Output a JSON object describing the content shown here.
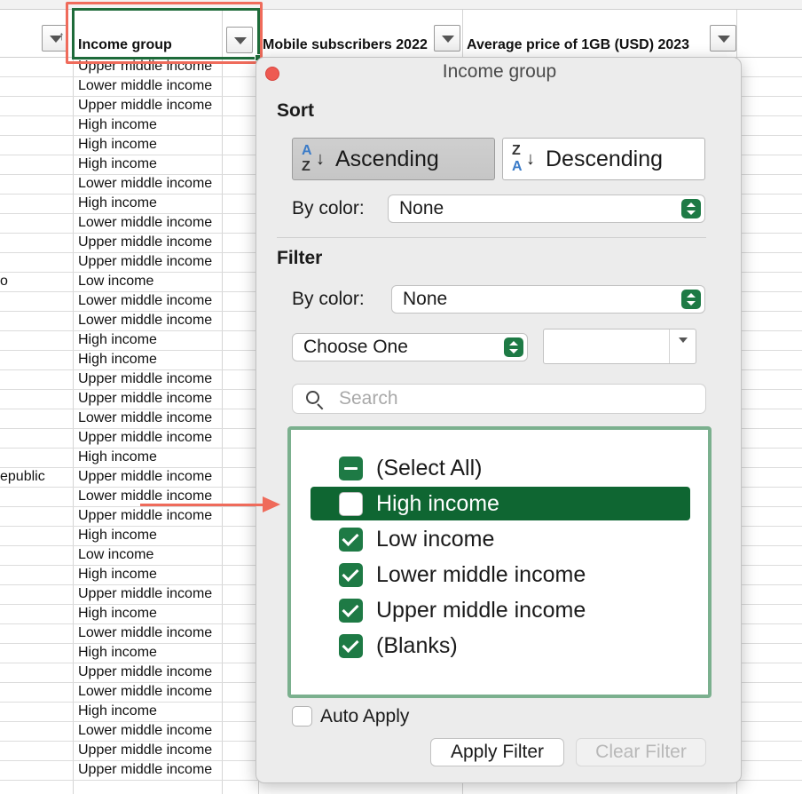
{
  "sheet": {
    "headers": {
      "income_group": "Income group",
      "mobile_subscribers": "Mobile subscribers 2022",
      "avg_price": "Average price of 1GB (USD) 2023"
    },
    "rows": [
      {
        "left": "",
        "income": "Upper middle income"
      },
      {
        "left": "",
        "income": "Lower middle income"
      },
      {
        "left": "",
        "income": "Upper middle income"
      },
      {
        "left": "",
        "income": "High income"
      },
      {
        "left": "",
        "income": "High income"
      },
      {
        "left": "",
        "income": "High income"
      },
      {
        "left": "",
        "income": "Lower middle income"
      },
      {
        "left": "",
        "income": "High income"
      },
      {
        "left": "",
        "income": "Lower middle income"
      },
      {
        "left": "",
        "income": "Upper middle income"
      },
      {
        "left": "",
        "income": "Upper middle income"
      },
      {
        "left": "o",
        "income": "Low income"
      },
      {
        "left": "",
        "income": "Lower middle income"
      },
      {
        "left": "",
        "income": "Lower middle income"
      },
      {
        "left": "",
        "income": "High income"
      },
      {
        "left": "",
        "income": "High income"
      },
      {
        "left": "",
        "income": "Upper middle income"
      },
      {
        "left": "",
        "income": "Upper middle income"
      },
      {
        "left": "",
        "income": "Lower middle income"
      },
      {
        "left": "",
        "income": "Upper middle income"
      },
      {
        "left": "",
        "income": "High income"
      },
      {
        "left": "epublic",
        "income": "Upper middle income"
      },
      {
        "left": "",
        "income": "Lower middle income"
      },
      {
        "left": "",
        "income": "Upper middle income"
      },
      {
        "left": "",
        "income": "High income"
      },
      {
        "left": "",
        "income": "Low income"
      },
      {
        "left": "",
        "income": "High income"
      },
      {
        "left": "",
        "income": "Upper middle income"
      },
      {
        "left": "",
        "income": "High income"
      },
      {
        "left": "",
        "income": "Lower middle income"
      },
      {
        "left": "",
        "income": "High income"
      },
      {
        "left": "",
        "income": "Upper middle income"
      },
      {
        "left": "",
        "income": "Lower middle income"
      },
      {
        "left": "",
        "income": "High income"
      },
      {
        "left": "",
        "income": "Lower middle income"
      },
      {
        "left": "",
        "income": "Upper middle income"
      },
      {
        "left": "",
        "income": "Upper middle income"
      }
    ]
  },
  "popup": {
    "title": "Income group",
    "sort": {
      "heading": "Sort",
      "ascending_label": "Ascending",
      "descending_label": "Descending",
      "ascending_pressed": true,
      "az_top": "A",
      "az_bottom": "Z",
      "za_top": "Z",
      "za_bottom": "A",
      "by_color_label": "By color:",
      "by_color_value": "None"
    },
    "filter": {
      "heading": "Filter",
      "by_color_label": "By color:",
      "by_color_value": "None",
      "condition_value": "Choose One",
      "condition_input_value": "",
      "search_placeholder": "Search",
      "items": [
        {
          "label": "(Select All)",
          "state": "mixed",
          "selected": false
        },
        {
          "label": "High income",
          "state": "unchecked",
          "selected": true
        },
        {
          "label": "Low income",
          "state": "checked",
          "selected": false
        },
        {
          "label": "Lower middle income",
          "state": "checked",
          "selected": false
        },
        {
          "label": "Upper middle income",
          "state": "checked",
          "selected": false
        },
        {
          "label": "(Blanks)",
          "state": "checked",
          "selected": false
        }
      ]
    },
    "auto_apply_label": "Auto Apply",
    "auto_apply_checked": false,
    "apply_filter_label": "Apply Filter",
    "clear_filter_label": "Clear Filter"
  },
  "colors": {
    "accent_green": "#1e7a45",
    "selected_row": "#0f6632",
    "list_border": "#7bb08e",
    "annotation_red": "#ef6b5b"
  }
}
